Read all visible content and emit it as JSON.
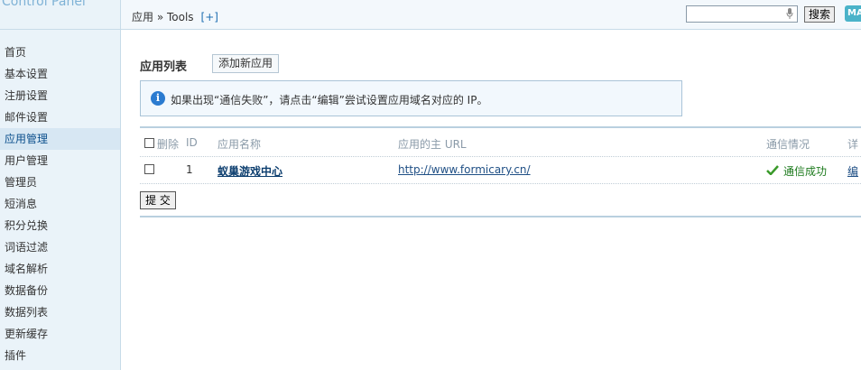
{
  "logo_text": "Control Panel",
  "sidebar": {
    "items": [
      {
        "label": "首页"
      },
      {
        "label": "基本设置"
      },
      {
        "label": "注册设置"
      },
      {
        "label": "邮件设置"
      },
      {
        "label": "应用管理",
        "active": true
      },
      {
        "label": "用户管理"
      },
      {
        "label": "管理员"
      },
      {
        "label": "短消息"
      },
      {
        "label": "积分兑换"
      },
      {
        "label": "词语过滤"
      },
      {
        "label": "域名解析"
      },
      {
        "label": "数据备份"
      },
      {
        "label": "数据列表"
      },
      {
        "label": "更新缓存"
      },
      {
        "label": "插件"
      }
    ]
  },
  "header": {
    "breadcrumb": "应用 » Tools",
    "add_link": "[+]",
    "search_placeholder": "",
    "search_button": "搜索",
    "badge": "MA"
  },
  "main": {
    "title": "应用列表",
    "add_button": "添加新应用",
    "notice": "如果出现“通信失败”，请点击“编辑”尝试设置应用域名对应的 IP。",
    "columns": [
      "删除",
      "ID",
      "应用名称",
      "应用的主 URL",
      "通信情况",
      "详"
    ],
    "rows": [
      {
        "id": "1",
        "name": "蚁巢游戏中心",
        "url": "http://www.formicary.cn/",
        "status": "通信成功",
        "action": "编"
      }
    ],
    "submit_button": "提 交"
  },
  "colors": {
    "sidebar_bg": "#eaf3f9",
    "active_item_bg": "#d7e7f3",
    "success": "#1c7a1c",
    "link": "#1f4f85",
    "info": "#2b7bd0"
  }
}
